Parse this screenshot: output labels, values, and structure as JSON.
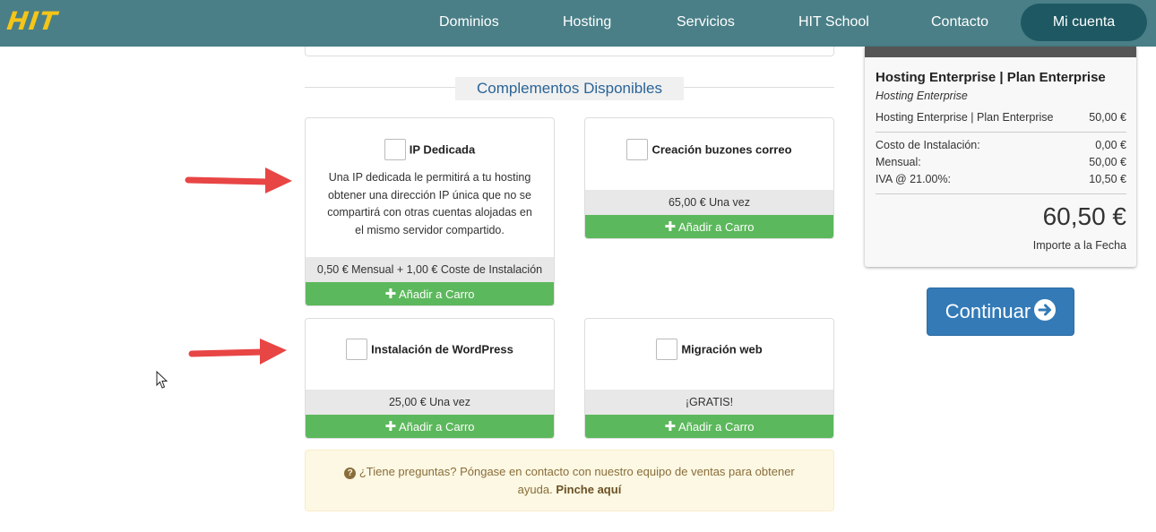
{
  "header": {
    "logo": "HIT",
    "nav": [
      "Dominios",
      "Hosting",
      "Servicios",
      "HIT School",
      "Contacto"
    ],
    "account_label": "Mi cuenta"
  },
  "section_title": "Complementos Disponibles",
  "addons": [
    {
      "name": "IP Dedicada",
      "description": "Una IP dedicada le permitirá a tu hosting obtener una dirección IP única que no se compartirá con otras cuentas alojadas en el mismo servidor compartido.",
      "price": "0,50 € Mensual + 1,00 € Coste de Instalación",
      "add_label": "Añadir a Carro"
    },
    {
      "name": "Creación buzones correo",
      "price": "65,00 € Una vez",
      "add_label": "Añadir a Carro"
    },
    {
      "name": "Instalación de WordPress",
      "price": "25,00 € Una vez",
      "add_label": "Añadir a Carro"
    },
    {
      "name": "Migración web",
      "price": "¡GRATIS!",
      "add_label": "Añadir a Carro"
    }
  ],
  "help": {
    "text": "¿Tiene preguntas? Póngase en contacto con nuestro equipo de ventas para obtener ayuda.",
    "link": "Pinche aquí"
  },
  "summary": {
    "title": "Hosting Enterprise | Plan Enterprise",
    "subtitle": "Hosting Enterprise",
    "item_label": "Hosting Enterprise | Plan Enterprise",
    "item_value": "50,00 €",
    "lines": [
      {
        "label": "Costo de Instalación:",
        "value": "0,00 €"
      },
      {
        "label": "Mensual:",
        "value": "50,00 €"
      },
      {
        "label": "IVA @ 21.00%:",
        "value": "10,50 €"
      }
    ],
    "total": "60,50 €",
    "total_label": "Importe a la Fecha"
  },
  "continue_label": "Continuar",
  "colors": {
    "header": "#4a7f87",
    "account_pill": "#1e5963",
    "logo": "#f5c518",
    "add_button": "#5cb85c",
    "primary": "#337ab7",
    "arrow": "#e84545"
  }
}
